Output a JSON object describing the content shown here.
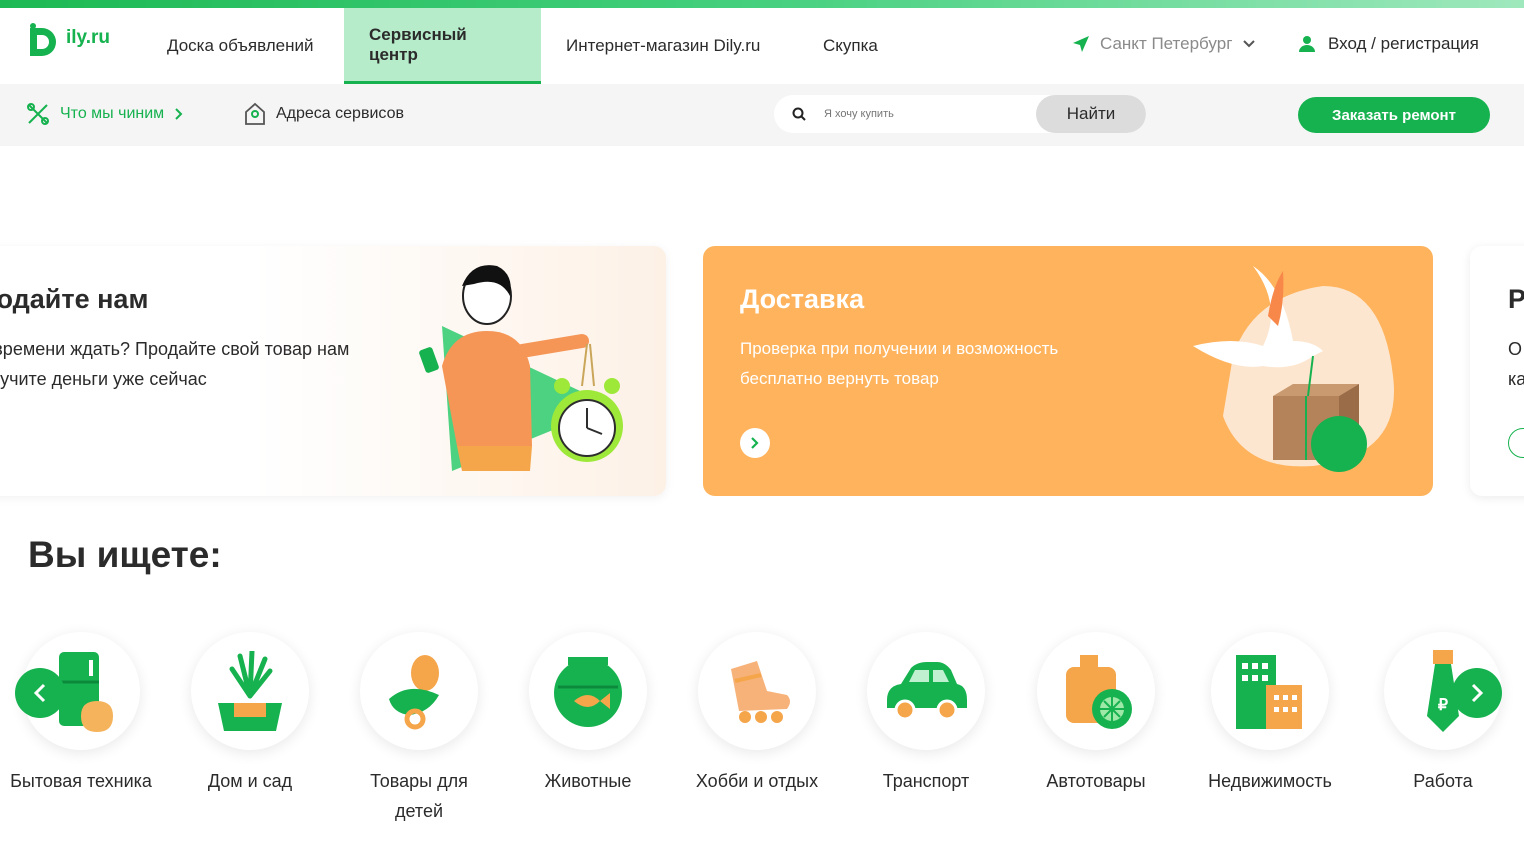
{
  "header": {
    "logo_text": "ily.ru",
    "nav": [
      {
        "label": "Доска объявлений"
      },
      {
        "label": "Сервисный центр"
      },
      {
        "label": "Интернет-магазин Dily.ru"
      },
      {
        "label": "Скупка"
      }
    ],
    "city": "Санкт Петербург",
    "login": "Вход / регистрация"
  },
  "subbar": {
    "what_we_fix": "Что мы чиним",
    "service_addresses": "Адреса сервисов",
    "search_placeholder": "Я хочу купить",
    "search_button": "Найти",
    "order_button": "Заказать ремонт"
  },
  "banners": [
    {
      "title": "родайте нам",
      "line1": "т времени ждать? Продайте свой товар нам",
      "line2": "олучите деньги уже сейчас"
    },
    {
      "title": "Доставка",
      "line1": "Проверка при получении и возможность",
      "line2": "бесплатно вернуть товар"
    },
    {
      "title": "Р",
      "line1": "О",
      "line2": "ка"
    }
  ],
  "section_title": "Вы ищете:",
  "categories": [
    {
      "label": "Бытовая техника",
      "icon": "fridge-icon"
    },
    {
      "label": "Дом и сад",
      "icon": "plant-icon"
    },
    {
      "label": "Товары для детей",
      "icon": "pacifier-icon"
    },
    {
      "label": "Животные",
      "icon": "aquarium-icon"
    },
    {
      "label": "Хобби и отдых",
      "icon": "rollerskate-icon"
    },
    {
      "label": "Транспорт",
      "icon": "car-icon"
    },
    {
      "label": "Автотовары",
      "icon": "canister-icon"
    },
    {
      "label": "Недвижимость",
      "icon": "building-icon"
    },
    {
      "label": "Работа",
      "icon": "tie-icon"
    }
  ],
  "colors": {
    "brand": "#16b24f",
    "orange": "#ffb35c",
    "active_tab": "#b6ecca"
  }
}
